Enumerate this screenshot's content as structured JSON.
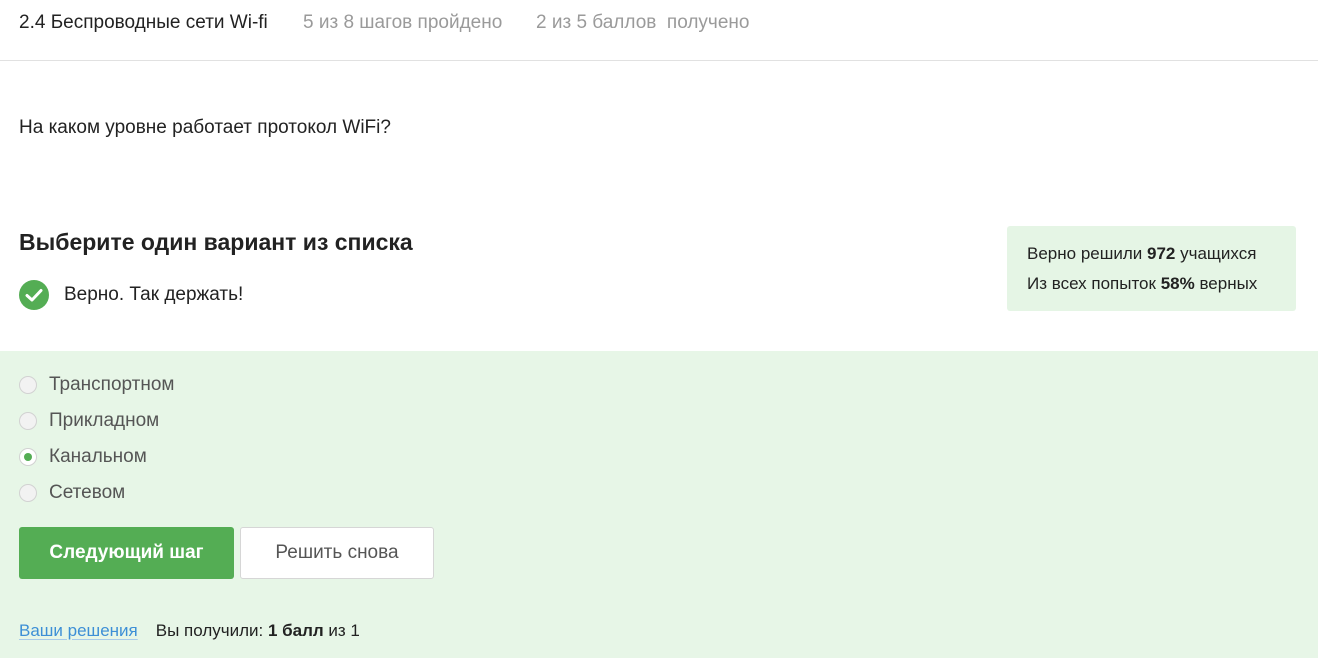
{
  "header": {
    "lesson_title": "2.4 Беспроводные сети Wi-fi",
    "steps_progress": "5 из 8 шагов пройдено",
    "score_progress": "2 из 5 баллов  получено"
  },
  "question": {
    "text": "На каком уровне работает протокол WiFi?"
  },
  "quiz": {
    "heading": "Выберите один вариант из списка",
    "feedback_text": "Верно. Так держать!",
    "feedback_icon": "checkmark-circle-icon",
    "options": [
      {
        "label": "Транспортном",
        "selected": false
      },
      {
        "label": "Прикладном",
        "selected": false
      },
      {
        "label": "Канальном",
        "selected": true
      },
      {
        "label": "Сетевом",
        "selected": false
      }
    ],
    "next_button_label": "Следующий шаг",
    "retry_button_label": "Решить снова"
  },
  "stats": {
    "solved_prefix": "Верно решили ",
    "solved_count": "972",
    "solved_suffix": " учащихся",
    "attempts_prefix": "Из всех попыток ",
    "attempts_percent": "58%",
    "attempts_suffix": " верных"
  },
  "results": {
    "solutions_link": "Ваши решения",
    "received_prefix": "Вы получили: ",
    "received_points": "1 балл",
    "received_suffix": " из 1"
  },
  "colors": {
    "accent_green": "#54ad54",
    "answers_background": "#e7f6e7",
    "stats_background": "#e5f5e5",
    "link_blue": "#3d8fd6"
  }
}
